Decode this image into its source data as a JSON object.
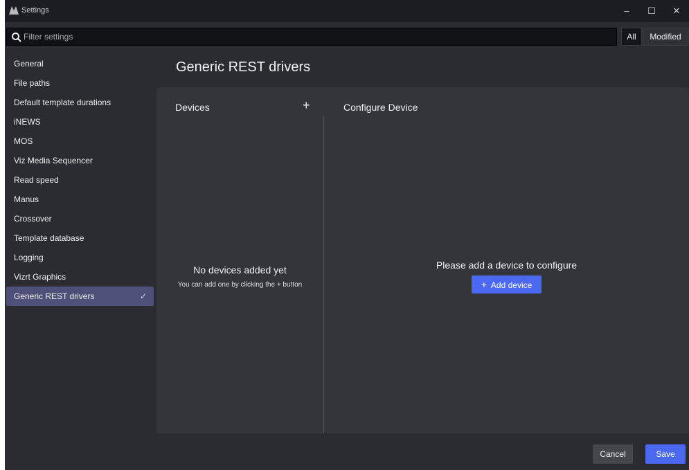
{
  "window": {
    "title": "Settings",
    "controls": {
      "minimize": "–",
      "maximize": "☐",
      "close": "✕"
    }
  },
  "filter": {
    "placeholder": "Filter settings",
    "value": "",
    "toggle_all": "All",
    "toggle_modified": "Modified",
    "selected": "All"
  },
  "sidebar": {
    "items": [
      {
        "label": "General"
      },
      {
        "label": "File paths"
      },
      {
        "label": "Default template durations"
      },
      {
        "label": "iNEWS"
      },
      {
        "label": "MOS"
      },
      {
        "label": "Viz Media Sequencer"
      },
      {
        "label": "Read speed"
      },
      {
        "label": "Manus"
      },
      {
        "label": "Crossover"
      },
      {
        "label": "Template database"
      },
      {
        "label": "Logging"
      },
      {
        "label": "Vizrt Graphics"
      },
      {
        "label": "Generic REST drivers",
        "active": true,
        "check": "✓"
      }
    ]
  },
  "main": {
    "title": "Generic REST drivers",
    "devices": {
      "title": "Devices",
      "add_icon": "+",
      "empty_title": "No devices added yet",
      "empty_sub": "You can add one by clicking the + button"
    },
    "configure": {
      "title": "Configure Device",
      "empty_text": "Please add a device to configure",
      "add_button_icon": "+",
      "add_button_label": "Add device"
    }
  },
  "footer": {
    "cancel_label": "Cancel",
    "save_label": "Save"
  },
  "colors": {
    "accent": "#4a68f0",
    "active_nav": "#4d5078",
    "background": "#2a2c31",
    "panel": "#33353b"
  }
}
